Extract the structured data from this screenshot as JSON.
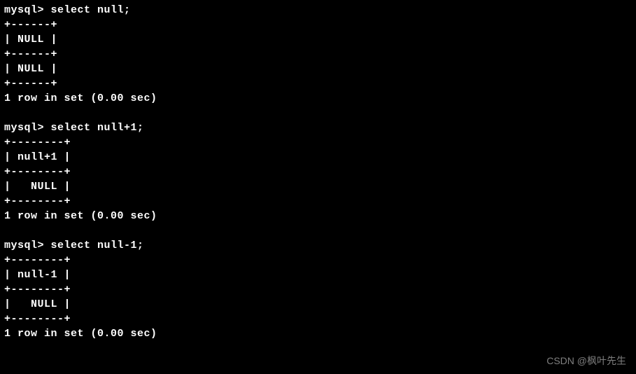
{
  "prompt": "mysql> ",
  "queries": [
    {
      "command": "select null;",
      "border_top": "+------+",
      "header_row": "| NULL |",
      "data_row": "| NULL |",
      "status": "1 row in set (0.00 sec)"
    },
    {
      "command": "select null+1;",
      "border_top": "+--------+",
      "header_row": "| null+1 |",
      "data_row": "|   NULL |",
      "status": "1 row in set (0.00 sec)"
    },
    {
      "command": "select null-1;",
      "border_top": "+--------+",
      "header_row": "| null-1 |",
      "data_row": "|   NULL |",
      "status": "1 row in set (0.00 sec)"
    }
  ],
  "watermark": "CSDN @枫叶先生"
}
